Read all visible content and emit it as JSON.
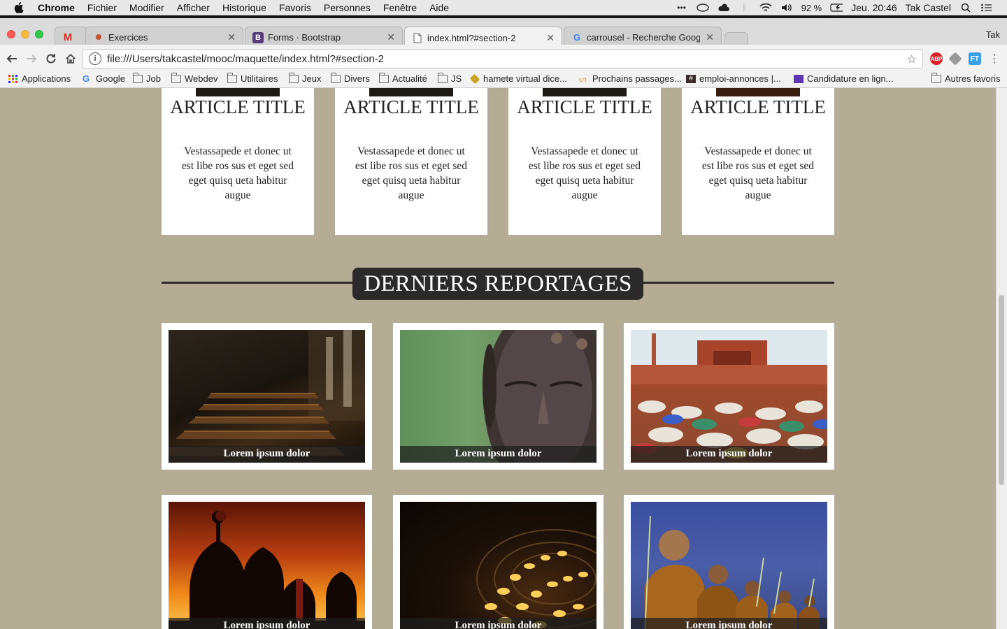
{
  "menubar": {
    "app": "Chrome",
    "items": [
      "Fichier",
      "Modifier",
      "Afficher",
      "Historique",
      "Favoris",
      "Personnes",
      "Fenêtre",
      "Aide"
    ],
    "battery": "92 %",
    "clock": "Jeu. 20:46",
    "user": "Tak Castel"
  },
  "tabs": [
    {
      "title": "",
      "favicon": "gmail-icon"
    },
    {
      "title": "Exercices",
      "favicon": "exercise-icon"
    },
    {
      "title": "Forms · Bootstrap",
      "favicon": "bootstrap-icon"
    },
    {
      "title": "index.html?#section-2",
      "favicon": "file-icon",
      "active": true
    },
    {
      "title": "carrousel - Recherche Google",
      "favicon": "google-icon"
    }
  ],
  "profile": "Tak",
  "address": "file:///Users/takcastel/mooc/maquette/index.html?#section-2",
  "bookmarks": [
    "Applications",
    "Google",
    "Job",
    "Webdev",
    "Utilitaires",
    "Jeux",
    "Divers",
    "Actualité",
    "JS",
    "hamete virtual dice...",
    "Prochains passages...",
    "emploi-annonces |...",
    "Candidature en lign..."
  ],
  "other_bookmarks": "Autres favoris",
  "articles": [
    {
      "title": "ARTICLE TITLE",
      "text": "Vestassapede et donec ut est libe ros sus et eget sed eget quisq ueta habitur augue"
    },
    {
      "title": "ARTICLE TITLE",
      "text": "Vestassapede et donec ut est libe ros sus et eget sed eget quisq ueta habitur augue"
    },
    {
      "title": "ARTICLE TITLE",
      "text": "Vestassapede et donec ut est libe ros sus et eget sed eget quisq ueta habitur augue"
    },
    {
      "title": "ARTICLE TITLE",
      "text": "Vestassapede et donec ut est libe ros sus et eget sed eget quisq ueta habitur augue"
    }
  ],
  "section_title": "DERNIERS REPORTAGES",
  "reports": [
    {
      "caption": "Lorem ipsum dolor",
      "image": "church-pews"
    },
    {
      "caption": "Lorem ipsum dolor",
      "image": "buddha-face"
    },
    {
      "caption": "Lorem ipsum dolor",
      "image": "mosque-prayer"
    },
    {
      "caption": "Lorem ipsum dolor",
      "image": "mosque-sunset"
    },
    {
      "caption": "Lorem ipsum dolor",
      "image": "candles"
    },
    {
      "caption": "Lorem ipsum dolor",
      "image": "monks"
    }
  ]
}
